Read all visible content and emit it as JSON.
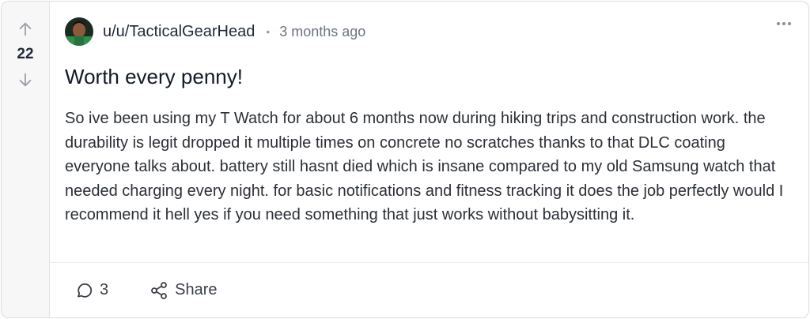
{
  "post": {
    "score": "22",
    "author": "u/u/TacticalGearHead",
    "separator": "•",
    "time_ago": "3 months ago",
    "title": "Worth every penny!",
    "body": "So ive been using my T Watch for about 6 months now during hiking trips and construction work. the durability is legit dropped it multiple times on concrete no scratches thanks to that DLC coating everyone talks about. battery still hasnt died which is insane compared to my old Samsung watch that needed charging every night. for basic notifications and fitness tracking it does the job perfectly would I recommend it hell yes if you need something that just works without babysitting it.",
    "comment_count": "3",
    "share_label": "Share"
  },
  "icons": {
    "upvote": "arrow-up-icon",
    "downvote": "arrow-down-icon",
    "more": "more-horizontal-icon",
    "comment": "comment-icon",
    "share": "share-icon"
  },
  "colors": {
    "rail_background": "#f7f7f8",
    "border": "#dcdcdc",
    "text_primary": "#1f2937",
    "text_muted": "#6b7280"
  }
}
